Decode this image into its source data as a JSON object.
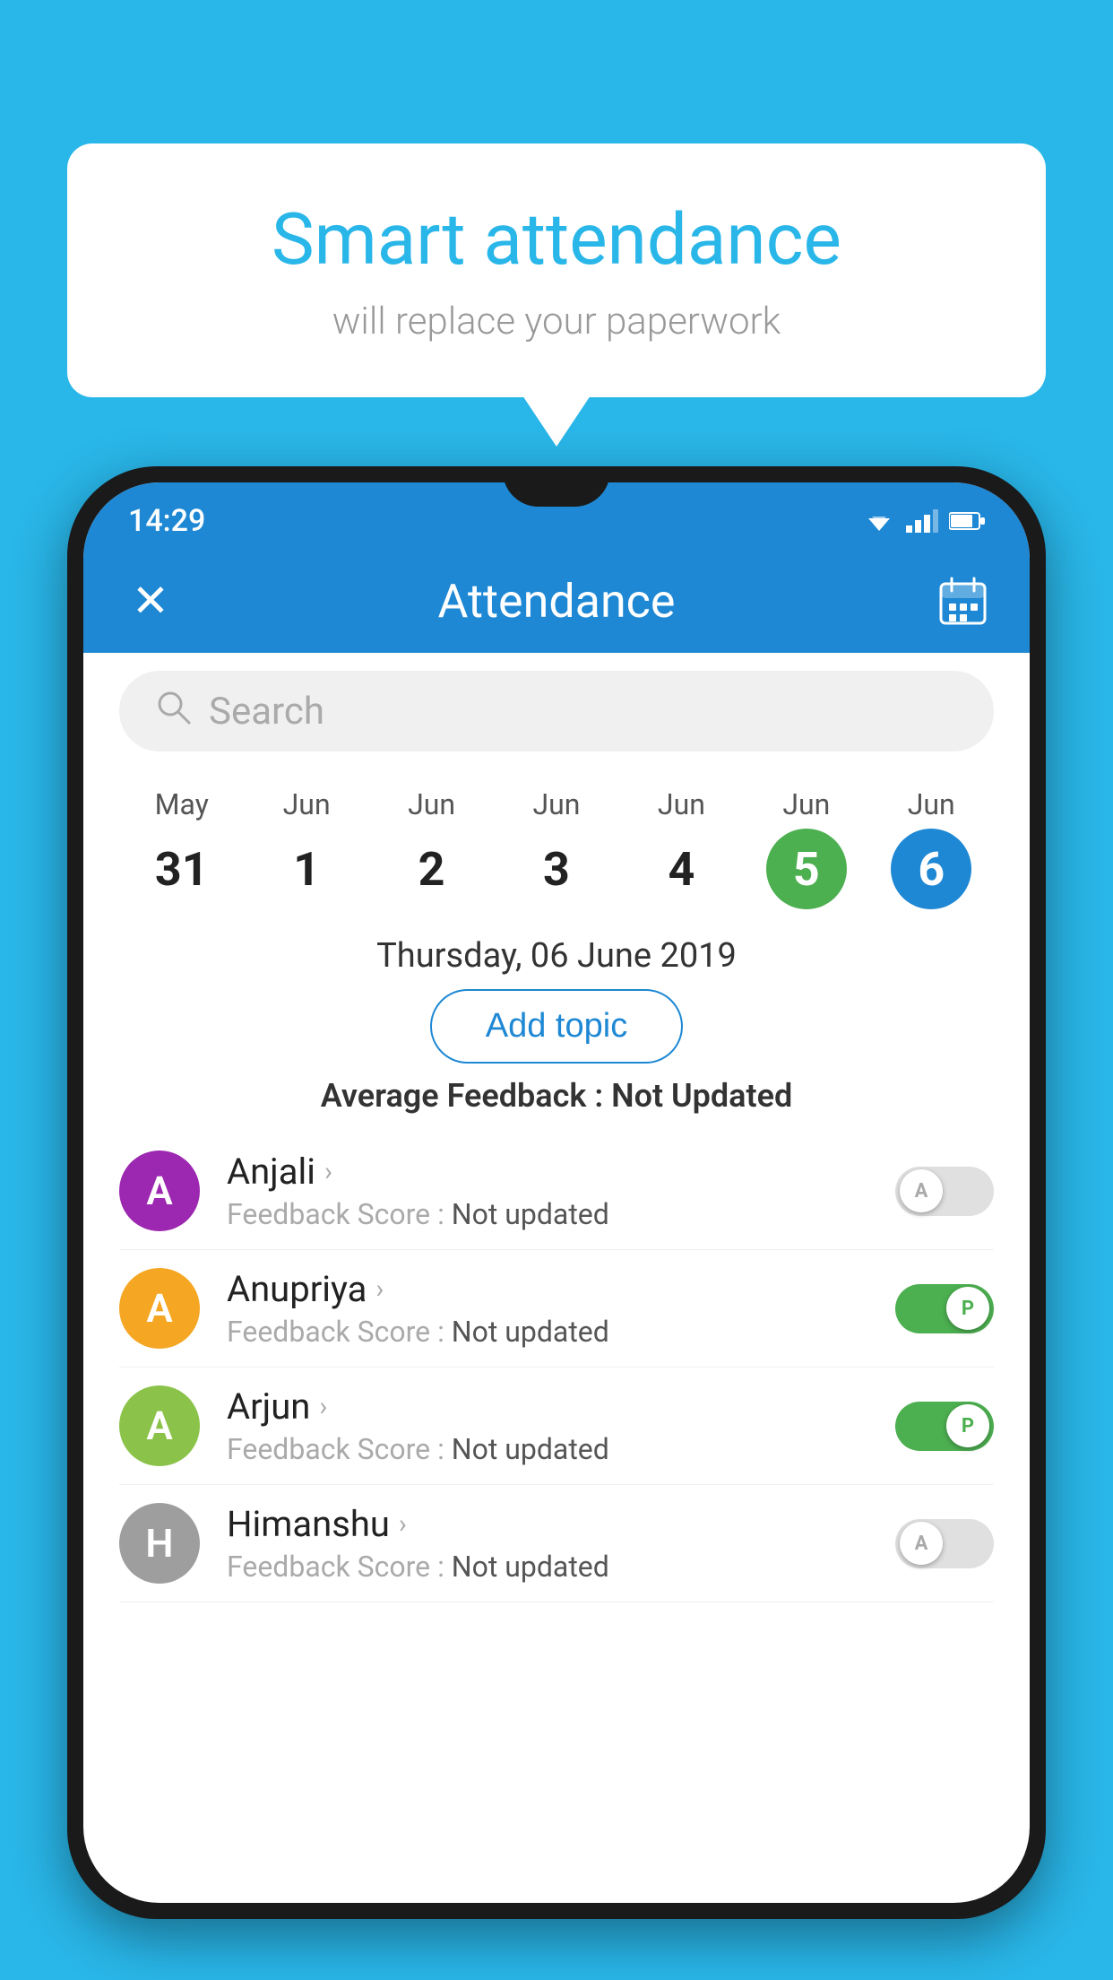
{
  "background": {
    "color": "#29b6e8"
  },
  "speech_bubble": {
    "title": "Smart attendance",
    "subtitle": "will replace your paperwork"
  },
  "status_bar": {
    "time": "14:29"
  },
  "app_bar": {
    "title": "Attendance",
    "close_label": "✕",
    "calendar_icon": "📅"
  },
  "search": {
    "placeholder": "Search"
  },
  "calendar": {
    "days": [
      {
        "month": "May",
        "date": "31",
        "state": "normal"
      },
      {
        "month": "Jun",
        "date": "1",
        "state": "normal"
      },
      {
        "month": "Jun",
        "date": "2",
        "state": "normal"
      },
      {
        "month": "Jun",
        "date": "3",
        "state": "normal"
      },
      {
        "month": "Jun",
        "date": "4",
        "state": "normal"
      },
      {
        "month": "Jun",
        "date": "5",
        "state": "today"
      },
      {
        "month": "Jun",
        "date": "6",
        "state": "selected"
      }
    ],
    "selected_date_label": "Thursday, 06 June 2019"
  },
  "add_topic_button": "Add topic",
  "avg_feedback": {
    "label": "Average Feedback : ",
    "value": "Not Updated"
  },
  "students": [
    {
      "name": "Anjali",
      "avatar_letter": "A",
      "avatar_color": "#9c27b0",
      "score_label": "Feedback Score : ",
      "score_value": "Not updated",
      "toggle_state": "off",
      "toggle_letter": "A"
    },
    {
      "name": "Anupriya",
      "avatar_letter": "A",
      "avatar_color": "#f5a623",
      "score_label": "Feedback Score : ",
      "score_value": "Not updated",
      "toggle_state": "on",
      "toggle_letter": "P"
    },
    {
      "name": "Arjun",
      "avatar_letter": "A",
      "avatar_color": "#8bc34a",
      "score_label": "Feedback Score : ",
      "score_value": "Not updated",
      "toggle_state": "on",
      "toggle_letter": "P"
    },
    {
      "name": "Himanshu",
      "avatar_letter": "H",
      "avatar_color": "#9e9e9e",
      "score_label": "Feedback Score : ",
      "score_value": "Not updated",
      "toggle_state": "off",
      "toggle_letter": "A"
    }
  ]
}
